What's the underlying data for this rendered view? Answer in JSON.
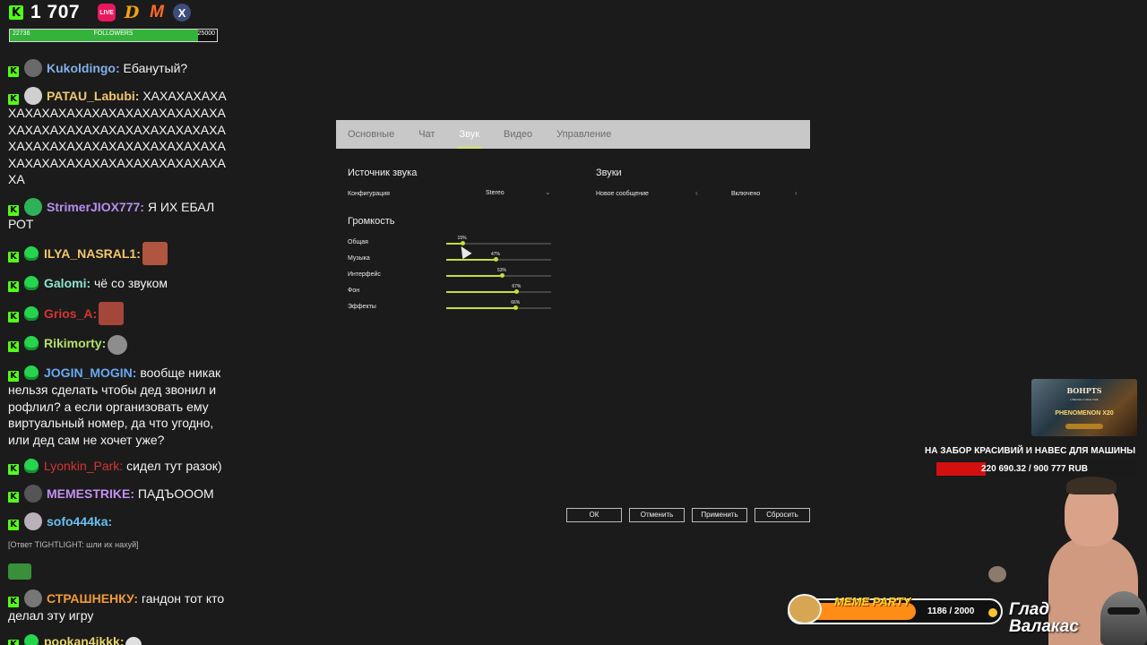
{
  "stream": {
    "viewer_count": "1 707",
    "platforms": [
      "LIVE",
      "D",
      "M",
      "X"
    ],
    "followers": {
      "current": "22736",
      "label": "FOLLOWERS",
      "goal": "25000",
      "progress": 0.91
    }
  },
  "chat": [
    {
      "nick": "Kukoldingo:",
      "color": "#7fb2e8",
      "text": " Ебанутый?"
    },
    {
      "nick": "PATAU_Labubi:",
      "color": "#f2c76c",
      "text": " ХАХАХАХАХАХАХАХАХАХАХАХАХАХАХАХАХАХАХАХАХАХАХАХАХАХАХАХАХАХАХАХАХАХАХАХАХАХАХАХАХАХАХАХАХАХАХАХАХАХАХАХАХАХАХАХАХАХА"
    },
    {
      "nick": "StrimerJIOX777:",
      "color": "#b58ff0",
      "text": " Я ИХ ЕБАЛ РОТ"
    },
    {
      "nick": "ILYA_NASRAL1:",
      "color": "#f2c76c",
      "text": ""
    },
    {
      "nick": "Galomi:",
      "color": "#8fe3d0",
      "text": " чё со звуком"
    },
    {
      "nick": "Grios_A:",
      "color": "#d63434",
      "text": ""
    },
    {
      "nick": "Rikimorty:",
      "color": "#b3e06a",
      "text": ""
    },
    {
      "nick": "JOGIN_MOGIN:",
      "color": "#6aa8f0",
      "text": " вообще никак нельзя сделать чтобы дед звонил и рофлил? а если организовать ему виртуальный номер, да что угодно, или дед сам не хочет уже?"
    },
    {
      "nick": "Lyonkin_Park:",
      "color": "#d63434",
      "text": " сидел тут разок)"
    },
    {
      "nick": "MEMESTRIKE:",
      "color": "#c58ff0",
      "text": " ПАДЪОООМ"
    },
    {
      "nick": "sofo444ka:",
      "color": "#6ac0f0",
      "text": ""
    },
    {
      "reply": "[Ответ TIGHTLIGHT: шли их нахуй]"
    },
    {
      "nick": "СТРАШНЕНКУ:",
      "color": "#f29b3a",
      "text": " гандон тот кто делал эту игру"
    },
    {
      "nick": "pookan4ikkk:",
      "color": "#e8d66a",
      "text": ""
    }
  ],
  "settings": {
    "tabs": [
      "Основные",
      "Чат",
      "Звук",
      "Видео",
      "Управление"
    ],
    "active_tab": "Звук",
    "source_title": "Источник звука",
    "config_label": "Конфигурация",
    "config_value": "Stereo",
    "sounds_title": "Звуки",
    "new_msg_label": "Новое сообщение",
    "new_msg_value": "Включено",
    "volume_title": "Громкость",
    "sliders": [
      {
        "label": "Общая",
        "value": 15,
        "pct": "15%"
      },
      {
        "label": "Музыка",
        "value": 47,
        "pct": "47%"
      },
      {
        "label": "Интерфейс",
        "value": 53,
        "pct": "53%"
      },
      {
        "label": "Фон",
        "value": 67,
        "pct": "67%"
      },
      {
        "label": "Эффекты",
        "value": 66,
        "pct": "66%"
      }
    ],
    "buttons": {
      "ok": "ОК",
      "cancel": "Отменить",
      "apply": "Применить",
      "reset": "Сбросить"
    }
  },
  "promo": {
    "brand": "ВОНРТS",
    "subtitle": "LINEAGE 2 HIGH FIVE",
    "title": "PHENOMENON X20"
  },
  "goal": {
    "title": "НА ЗАБОР КРАСИВИЙ И НАВЕС ДЛЯ МАШИНЫ",
    "text": "220 690.32 / 900 777 RUB",
    "progress": 0.245
  },
  "meme_party": {
    "label": "MEME PARTY",
    "count": "1186 / 2000",
    "progress": 0.593
  },
  "nameplate": {
    "line1": "Глад",
    "line2": "Валакас"
  },
  "colors": {
    "kick_green": "#53fc18",
    "slider_accent": "#c7dd3a",
    "goal_red": "#d40f0f",
    "meme_orange": "#ff8c16"
  }
}
